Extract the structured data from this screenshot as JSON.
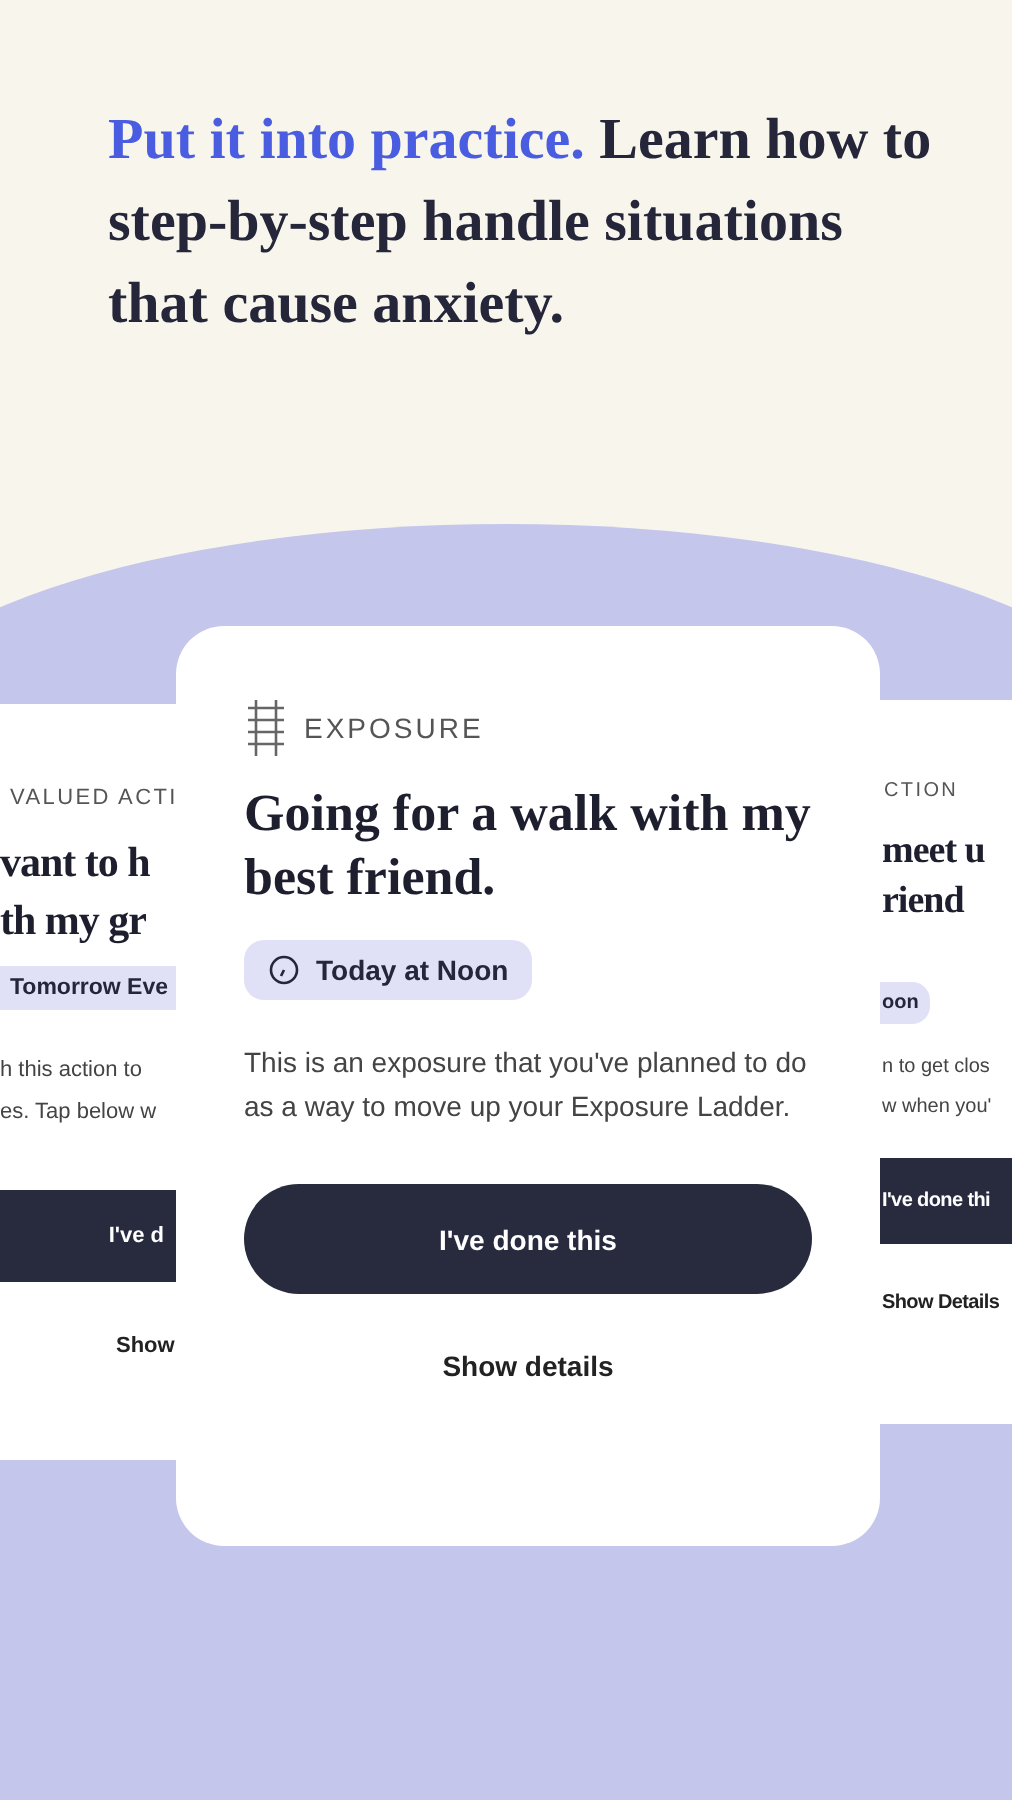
{
  "headline": {
    "highlight": "Put it into practice.",
    "text": "Learn how to step-by-step handle situations that cause anxiety."
  },
  "cards": [
    {
      "kind": "left",
      "category": "VALUED ACTI",
      "title_lines": [
        "vant to h",
        "th my gr"
      ],
      "time": "Tomorrow Eve",
      "description_lines": [
        "h this action to",
        "es. Tap below w"
      ],
      "done_button": "I've d",
      "details_link": "Show"
    },
    {
      "kind": "center",
      "category": "EXPOSURE",
      "title": "Going for a walk with my best friend.",
      "time": "Today at Noon",
      "description": "This is an exposure that you've planned to do as a way to move up your Exposure Ladder.",
      "done_button": "I've done this",
      "details_link": "Show details"
    },
    {
      "kind": "right",
      "category": "CTION",
      "title_lines": [
        "meet u",
        "riend"
      ],
      "time": "oon",
      "description_lines": [
        "n to get clos",
        "w when you'"
      ],
      "done_button": "I've done thi",
      "details_link": "Show Details"
    }
  ]
}
